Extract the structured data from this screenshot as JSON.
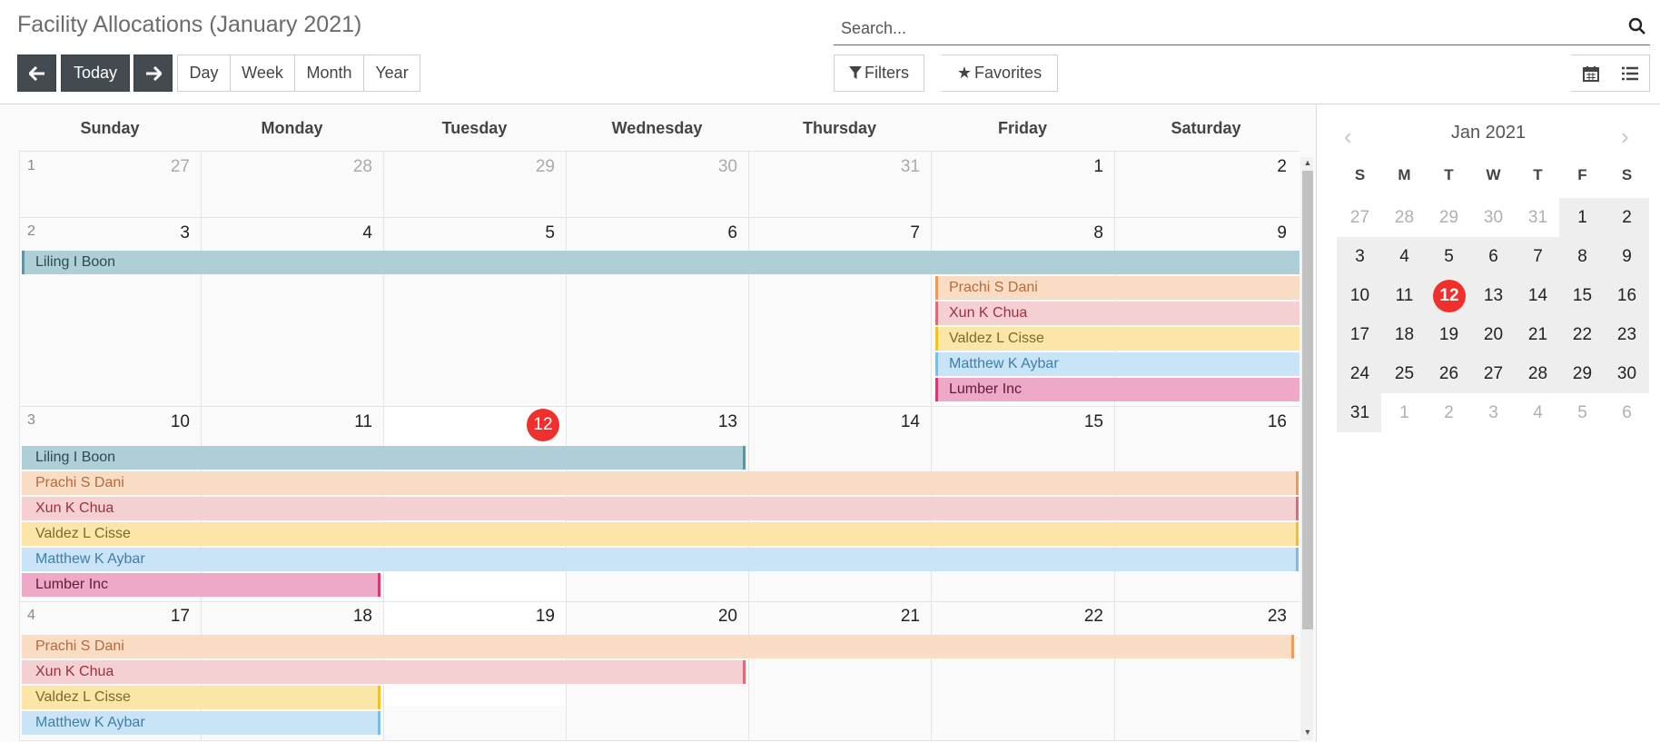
{
  "title": "Facility Allocations (January 2021)",
  "nav": {
    "today_label": "Today"
  },
  "scale_buttons": [
    "Day",
    "Week",
    "Month",
    "Year"
  ],
  "search": {
    "placeholder": "Search..."
  },
  "filters_label": "Filters",
  "favorites_label": "Favorites",
  "view_switch": [
    "calendar-view",
    "list-view"
  ],
  "weekdays": [
    "Sunday",
    "Monday",
    "Tuesday",
    "Wednesday",
    "Thursday",
    "Friday",
    "Saturday"
  ],
  "weeks": [
    {
      "num": "1",
      "days": [
        "27",
        "28",
        "29",
        "30",
        "31",
        "1",
        "2"
      ],
      "other": [
        true,
        true,
        true,
        true,
        true,
        false,
        false
      ]
    },
    {
      "num": "2",
      "days": [
        "3",
        "4",
        "5",
        "6",
        "7",
        "8",
        "9"
      ],
      "other": [
        false,
        false,
        false,
        false,
        false,
        false,
        false
      ]
    },
    {
      "num": "3",
      "days": [
        "10",
        "11",
        "12",
        "13",
        "14",
        "15",
        "16"
      ],
      "other": [
        false,
        false,
        false,
        false,
        false,
        false,
        false
      ]
    },
    {
      "num": "4",
      "days": [
        "17",
        "18",
        "19",
        "20",
        "21",
        "22",
        "23"
      ],
      "other": [
        false,
        false,
        false,
        false,
        false,
        false,
        false
      ]
    }
  ],
  "today": "12",
  "events": {
    "week2": [
      {
        "label": "Liling I Boon",
        "color": 0
      },
      {
        "label": "Prachi S Dani",
        "color": 1
      },
      {
        "label": "Xun K Chua",
        "color": 2
      },
      {
        "label": "Valdez L Cisse",
        "color": 3
      },
      {
        "label": "Matthew K Aybar",
        "color": 4
      },
      {
        "label": "Lumber Inc",
        "color": 5
      }
    ],
    "week3": [
      {
        "label": "Liling I Boon",
        "color": 0
      },
      {
        "label": "Prachi S Dani",
        "color": 1
      },
      {
        "label": "Xun K Chua",
        "color": 2
      },
      {
        "label": "Valdez L Cisse",
        "color": 3
      },
      {
        "label": "Matthew K Aybar",
        "color": 4
      },
      {
        "label": "Lumber Inc",
        "color": 5
      }
    ],
    "week4": [
      {
        "label": "Prachi S Dani",
        "color": 1
      },
      {
        "label": "Xun K Chua",
        "color": 2
      },
      {
        "label": "Valdez L Cisse",
        "color": 3
      },
      {
        "label": "Matthew K Aybar",
        "color": 4
      }
    ]
  },
  "event_colors": {
    "liling": "#aecfd8",
    "prachi": "#f8dcc4",
    "xun": "#f4d0d2",
    "valdez": "#fbe6a8",
    "matthew": "#c8e4f6",
    "lumber": "#eea8c8",
    "today_accent": "#f0302c"
  },
  "mini_calendar": {
    "month_label": "Jan 2021",
    "dow": [
      "S",
      "M",
      "T",
      "W",
      "T",
      "F",
      "S"
    ],
    "rows": [
      [
        "27",
        "28",
        "29",
        "30",
        "31",
        "1",
        "2"
      ],
      [
        "3",
        "4",
        "5",
        "6",
        "7",
        "8",
        "9"
      ],
      [
        "10",
        "11",
        "12",
        "13",
        "14",
        "15",
        "16"
      ],
      [
        "17",
        "18",
        "19",
        "20",
        "21",
        "22",
        "23"
      ],
      [
        "24",
        "25",
        "26",
        "27",
        "28",
        "29",
        "30"
      ],
      [
        "31",
        "1",
        "2",
        "3",
        "4",
        "5",
        "6"
      ]
    ],
    "today": "12"
  }
}
